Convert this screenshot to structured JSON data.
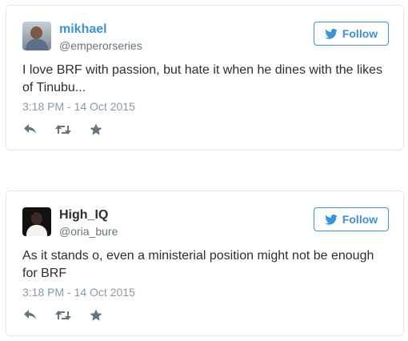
{
  "tweets": [
    {
      "name": "mikhael",
      "handle": "@emperorseries",
      "follow_label": "Follow",
      "text": "I love BRF with passion, but hate it when he dines with the likes of Tinubu...",
      "timestamp": "3:18 PM - 14 Oct 2015",
      "avatar_icon": "user-avatar",
      "actions": [
        "reply-icon",
        "retweet-icon",
        "favorite-icon"
      ]
    },
    {
      "name": "High_IQ",
      "handle": "@oria_bure",
      "follow_label": "Follow",
      "text": "As it stands o, even a ministerial position might not be enough for BRF",
      "timestamp": "3:18 PM - 14 Oct 2015",
      "avatar_icon": "user-avatar",
      "actions": [
        "reply-icon",
        "retweet-icon",
        "favorite-icon"
      ]
    }
  ],
  "colors": {
    "accent": "#3b94d9",
    "text": "#292f33",
    "muted": "#66757f",
    "timestamp": "#8899a6",
    "border": "#e1e8ed",
    "icon": "#66757f"
  }
}
